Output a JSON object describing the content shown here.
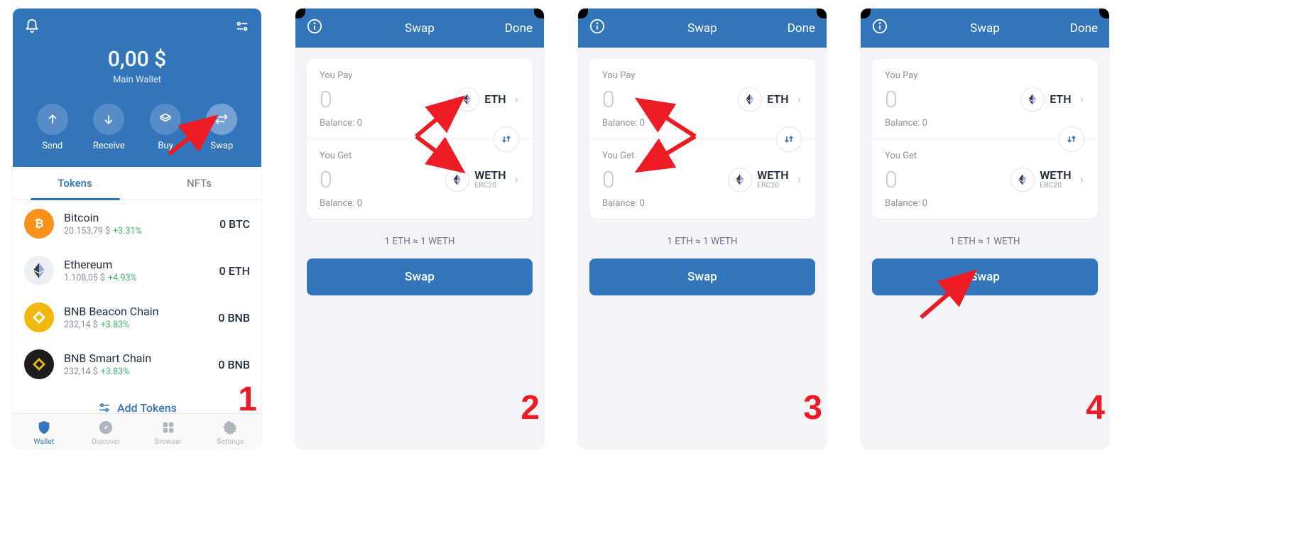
{
  "colors": {
    "primary": "#3375BB",
    "accent_red": "#ED1C24",
    "positive": "#3cb46e"
  },
  "screen1": {
    "balance": "0,00 $",
    "wallet_name": "Main Wallet",
    "actions": {
      "send": "Send",
      "receive": "Receive",
      "buy": "Buy",
      "swap": "Swap"
    },
    "tabs": {
      "tokens": "Tokens",
      "nfts": "NFTs"
    },
    "tokens": [
      {
        "name": "Bitcoin",
        "price": "20.153,79 $",
        "change": "+3.31%",
        "balance": "0 BTC"
      },
      {
        "name": "Ethereum",
        "price": "1.108,05 $",
        "change": "+4.93%",
        "balance": "0 ETH"
      },
      {
        "name": "BNB Beacon Chain",
        "price": "232,14 $",
        "change": "+3.83%",
        "balance": "0 BNB"
      },
      {
        "name": "BNB Smart Chain",
        "price": "232,14 $",
        "change": "+3.83%",
        "balance": "0 BNB"
      }
    ],
    "add_tokens": "Add Tokens",
    "bottom_nav": {
      "wallet": "Wallet",
      "discover": "Discover",
      "browser": "Browser",
      "settings": "Settings"
    }
  },
  "swap": {
    "title": "Swap",
    "done": "Done",
    "you_pay": "You Pay",
    "you_get": "You Get",
    "amount_placeholder": "0",
    "pay_token": "ETH",
    "pay_balance_label": "Balance: 0",
    "get_token": "WETH",
    "get_token_sub": "ERC20",
    "get_balance_label": "Balance: 0",
    "rate": "1 ETH ≈ 1 WETH",
    "swap_btn": "Swap"
  },
  "steps": {
    "s1": "1",
    "s2": "2",
    "s3": "3",
    "s4": "4"
  }
}
